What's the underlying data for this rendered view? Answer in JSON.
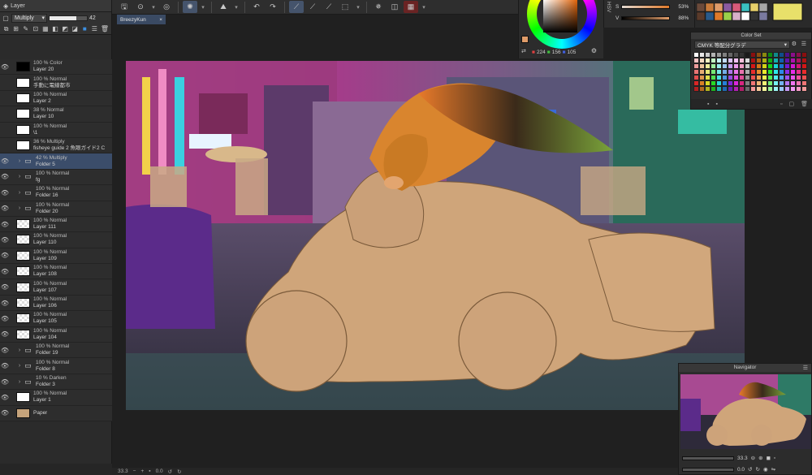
{
  "layer_panel": {
    "title": "Layer",
    "blend_mode": "Multiply",
    "opacity_value": "42",
    "layers": [
      {
        "mode": "100 % Color",
        "name": "Layer 20",
        "kind": "layer",
        "thumb": "black",
        "eye": true
      },
      {
        "mode": "100 % Normal",
        "name": "手動に電線都市",
        "kind": "layer",
        "thumb": "white",
        "eye": false
      },
      {
        "mode": "100 % Normal",
        "name": "Layer 2",
        "kind": "layer",
        "thumb": "white",
        "eye": false
      },
      {
        "mode": "38 % Normal",
        "name": "Layer 10",
        "kind": "layer",
        "thumb": "white",
        "eye": false
      },
      {
        "mode": "100 % Normal",
        "name": "\\1",
        "kind": "layer",
        "thumb": "white",
        "eye": false
      },
      {
        "mode": "36 % Multiply",
        "name": "fisheye guide 2 魚眼ガイド2 C",
        "kind": "layer",
        "thumb": "white",
        "eye": false
      },
      {
        "mode": "42 % Multiply",
        "name": "Folder 5",
        "kind": "folder",
        "eye": true,
        "selected": true
      },
      {
        "mode": "100 % Normal",
        "name": "fg",
        "kind": "folder",
        "eye": true
      },
      {
        "mode": "100 % Normal",
        "name": "Folder 16",
        "kind": "folder",
        "eye": true
      },
      {
        "mode": "100 % Normal",
        "name": "Folder 20",
        "kind": "folder",
        "eye": true
      },
      {
        "mode": "100 % Normal",
        "name": "Layer 111",
        "kind": "layer",
        "thumb": "checker",
        "eye": true
      },
      {
        "mode": "100 % Normal",
        "name": "Layer 110",
        "kind": "layer",
        "thumb": "checker",
        "eye": true
      },
      {
        "mode": "100 % Normal",
        "name": "Layer 109",
        "kind": "layer",
        "thumb": "checker",
        "eye": true
      },
      {
        "mode": "100 % Normal",
        "name": "Layer 108",
        "kind": "layer",
        "thumb": "checker",
        "eye": true
      },
      {
        "mode": "100 % Normal",
        "name": "Layer 107",
        "kind": "layer",
        "thumb": "checker",
        "eye": true
      },
      {
        "mode": "100 % Normal",
        "name": "Layer 106",
        "kind": "layer",
        "thumb": "checker",
        "eye": true
      },
      {
        "mode": "100 % Normal",
        "name": "Layer 105",
        "kind": "layer",
        "thumb": "checker",
        "eye": true
      },
      {
        "mode": "100 % Normal",
        "name": "Layer 104",
        "kind": "layer",
        "thumb": "checker",
        "eye": true
      },
      {
        "mode": "100 % Normal",
        "name": "Folder 19",
        "kind": "folder",
        "eye": true
      },
      {
        "mode": "100 % Normal",
        "name": "Folder 8",
        "kind": "folder",
        "eye": true
      },
      {
        "mode": "10 % Darken",
        "name": "Folder 3",
        "kind": "folder",
        "eye": true
      },
      {
        "mode": "100 % Normal",
        "name": "Layer 1",
        "kind": "layer",
        "thumb": "white",
        "eye": true
      },
      {
        "mode": "",
        "name": "Paper",
        "kind": "layer",
        "thumb": "tan",
        "eye": true
      }
    ]
  },
  "document_tab": {
    "title": "BreezyKun",
    "close": "×"
  },
  "color": {
    "r": "224",
    "g": "156",
    "b": "105",
    "main_color": "#e09c69"
  },
  "hsv": {
    "label": "HSV",
    "s_label": "S",
    "s_value": "53%",
    "v_label": "V",
    "v_value": "88%"
  },
  "color_set": {
    "title": "Color Set",
    "set_name": "CMYK 等配分グラデ"
  },
  "navigator": {
    "title": "Navigator",
    "zoom": "33.3",
    "angle": "0.0"
  },
  "status_bar": {
    "zoom": "33.3",
    "angle": "0.0"
  }
}
